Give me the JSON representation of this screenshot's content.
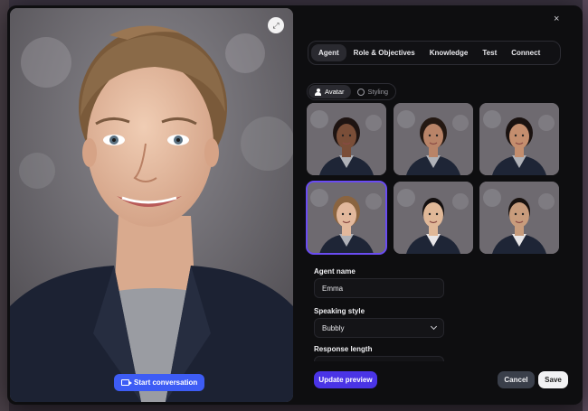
{
  "modal": {
    "close_glyph": "×",
    "expand_glyph": "⤢"
  },
  "preview": {
    "start_label": "Start conversation"
  },
  "tabs": [
    {
      "label": "Agent",
      "active": true
    },
    {
      "label": "Role & Objectives",
      "active": false
    },
    {
      "label": "Knowledge",
      "active": false
    },
    {
      "label": "Test",
      "active": false
    },
    {
      "label": "Connect",
      "active": false
    }
  ],
  "segment": {
    "avatar_label": "Avatar",
    "styling_label": "Styling",
    "active": "Avatar"
  },
  "avatars": [
    {
      "id": "female-1",
      "skin": "#7a4e38",
      "hair": "#1e1412",
      "selected": false
    },
    {
      "id": "female-2",
      "skin": "#b98468",
      "hair": "#241812",
      "selected": false
    },
    {
      "id": "female-3",
      "skin": "#c48e6e",
      "hair": "#1a1210",
      "selected": false
    },
    {
      "id": "female-4",
      "skin": "#e2b89c",
      "hair": "#8a6440",
      "selected": true
    },
    {
      "id": "male-1",
      "skin": "#e0b898",
      "hair": "#141010",
      "selected": false
    },
    {
      "id": "male-2",
      "skin": "#c89c7c",
      "hair": "#18110e",
      "selected": false
    }
  ],
  "form": {
    "agent_name_label": "Agent name",
    "agent_name_value": "Emma",
    "speaking_style_label": "Speaking style",
    "speaking_style_value": "Bubbly",
    "response_length_label": "Response length"
  },
  "actions": {
    "update_label": "Update preview",
    "cancel_label": "Cancel",
    "save_label": "Save"
  },
  "colors": {
    "accent": "#4a34e6",
    "start_button": "#3d5cf5",
    "selected_outline": "#6a4cf2"
  }
}
